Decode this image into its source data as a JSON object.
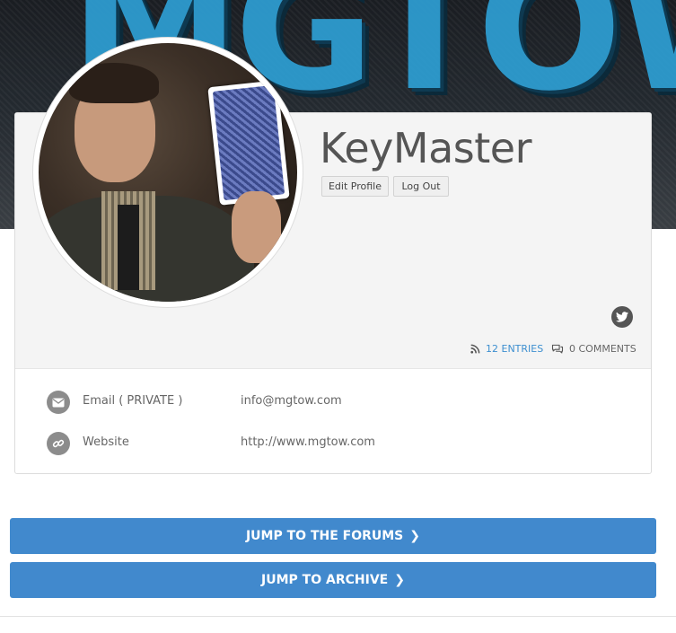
{
  "banner": {
    "text": "MGTOW"
  },
  "profile": {
    "username": "KeyMaster",
    "buttons": {
      "edit": "Edit Profile",
      "logout": "Log Out"
    },
    "social": {
      "twitter_icon": "twitter-icon"
    },
    "stats": {
      "entries": "12 ENTRIES",
      "comments": "0 COMMENTS"
    }
  },
  "info": [
    {
      "icon": "envelope-icon",
      "label": "Email ( PRIVATE )",
      "value": "info@mgtow.com"
    },
    {
      "icon": "link-icon",
      "label": "Website",
      "value": "http://www.mgtow.com"
    }
  ],
  "jumps": [
    {
      "label": "JUMP TO THE FORUMS",
      "chevron": "❯"
    },
    {
      "label": "JUMP TO ARCHIVE",
      "chevron": "❯"
    }
  ],
  "colors": {
    "accent": "#4189cd",
    "link": "#3d8fd0",
    "banner_text": "#2e9fd4"
  }
}
